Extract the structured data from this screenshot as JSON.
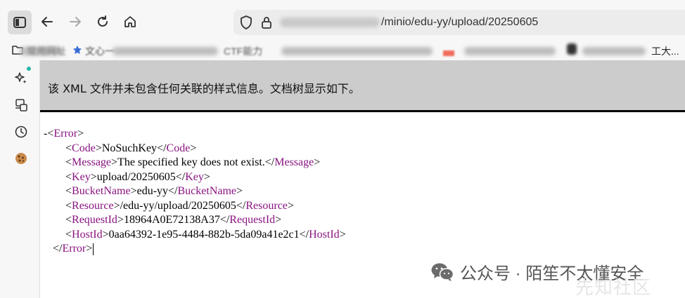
{
  "browser": {
    "url_visible": "/minio/edu-yy/upload/20250605"
  },
  "bookmarks": {
    "items": [
      {
        "label": "常用网址"
      },
      {
        "label": "文心一"
      },
      {
        "label": "CTF能力"
      },
      {
        "label": "工大..."
      }
    ]
  },
  "notice": {
    "text": "该 XML 文件并未包含任何关联的样式信息。文档树显示如下。"
  },
  "xml": {
    "collapse_symbol": "-",
    "root_tag": "Error",
    "children": [
      {
        "tag": "Code",
        "value": "NoSuchKey"
      },
      {
        "tag": "Message",
        "value": "The specified key does not exist."
      },
      {
        "tag": "Key",
        "value": "upload/20250605"
      },
      {
        "tag": "BucketName",
        "value": "edu-yy"
      },
      {
        "tag": "Resource",
        "value": "/edu-yy/upload/20250605"
      },
      {
        "tag": "RequestId",
        "value": "18964A0E72138A37"
      },
      {
        "tag": "HostId",
        "value": "0aa64392-1e95-4484-882b-5da09a41e2c1"
      }
    ]
  },
  "watermark": {
    "text": "公众号 · 陌笙不太懂安全",
    "faint_text": "先知社区"
  },
  "colors": {
    "tag": "#881280",
    "notice_bg": "#cccccc",
    "toolbar_bg": "#f7f7f7",
    "sidebar_dot": "#27b6a8"
  }
}
